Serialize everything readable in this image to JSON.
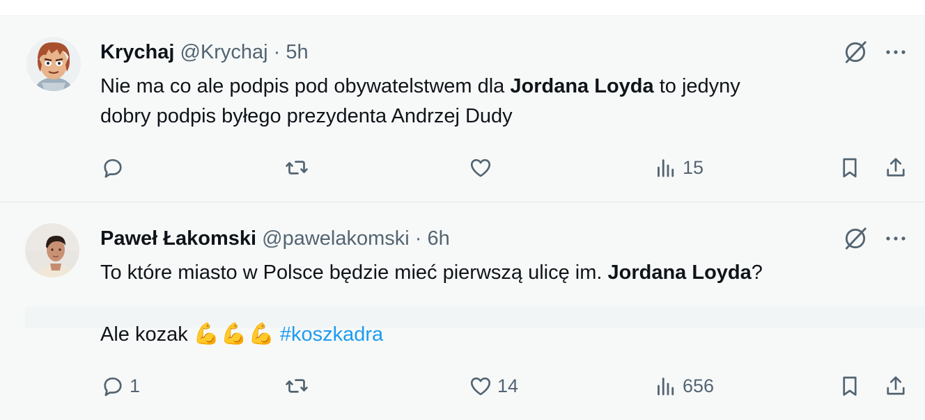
{
  "tweets": [
    {
      "display_name": "Krychaj",
      "handle": "@Krychaj",
      "separator": "·",
      "time": "5h",
      "text": {
        "line1_a": "Nie ma co ale podpis pod obywatelstwem dla ",
        "line1_bold": "Jordana Loyda",
        "line1_b": " to jedyny",
        "line2": "dobry podpis byłego prezydenta Andrzej Dudy"
      },
      "actions": {
        "replies": "",
        "retweets": "",
        "likes": "",
        "views": "15"
      },
      "avatar_icon": "cartoon-avatar",
      "grok_icon": "grok-icon",
      "more_icon": "more-icon"
    },
    {
      "display_name": "Paweł Łakomski",
      "handle": "@pawelakomski",
      "separator": "·",
      "time": "6h",
      "text": {
        "line1_a": "To które miasto w Polsce będzie mieć pierwszą ulicę im. ",
        "line1_bold": "Jordana Loyda",
        "line1_b": "?",
        "line3_a": "Ale kozak ",
        "emoji": [
          "💪",
          "💪",
          "💪"
        ],
        "hashtag": "#koszkadra"
      },
      "actions": {
        "replies": "1",
        "retweets": "",
        "likes": "14",
        "views": "656"
      },
      "avatar_icon": "profile-photo",
      "grok_icon": "grok-icon",
      "more_icon": "more-icon"
    }
  ],
  "colors": {
    "text": "#0f1419",
    "secondary": "#536471",
    "link": "#1d9bf0",
    "background": "#f7f9f9"
  }
}
